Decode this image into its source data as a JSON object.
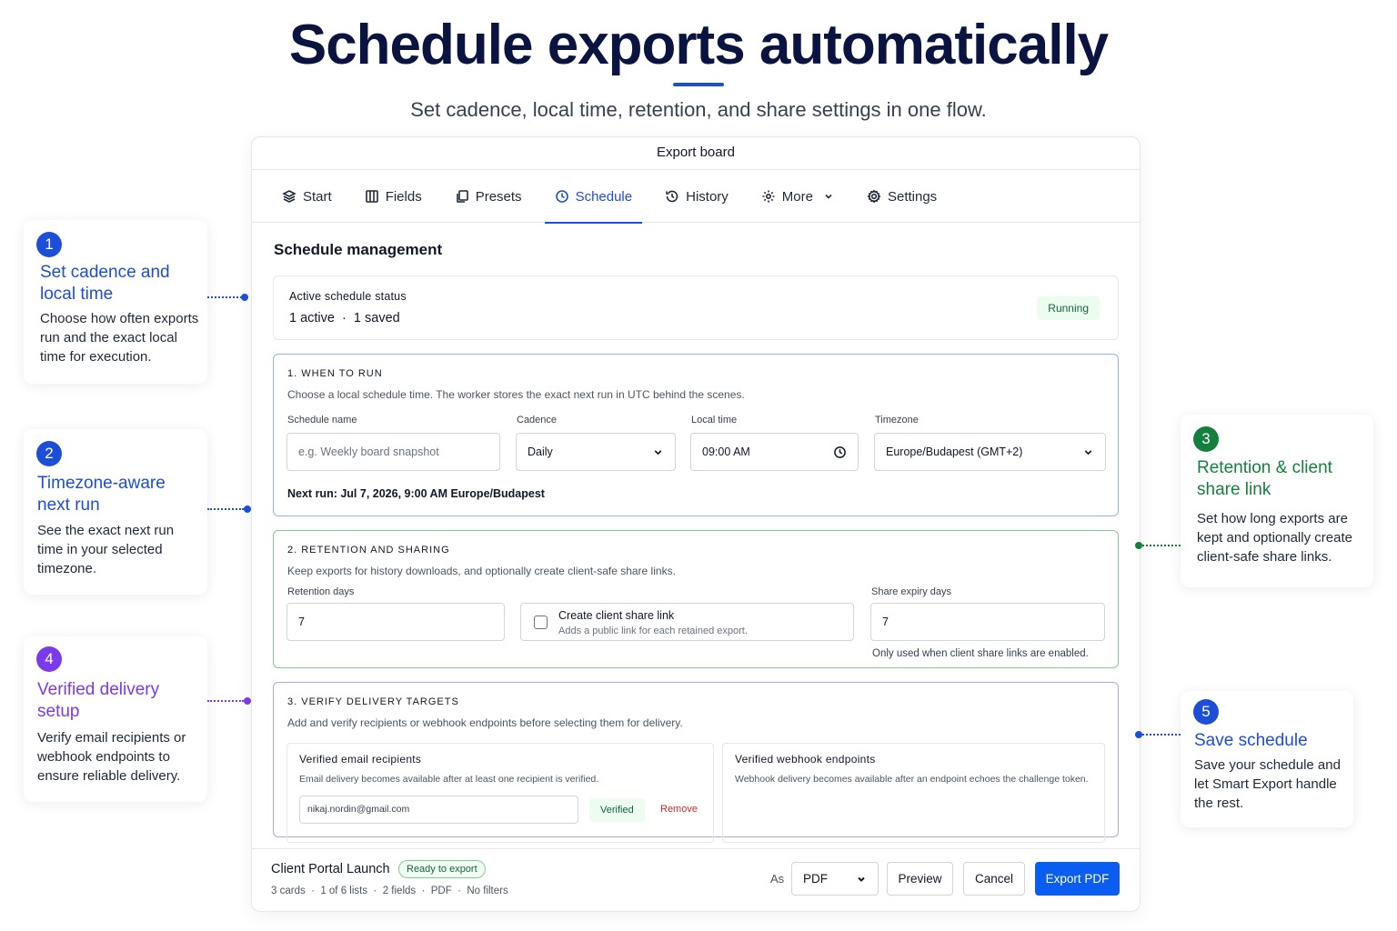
{
  "hero": {
    "title": "Schedule exports automatically",
    "subtitle": "Set cadence, local time, retention, and share settings in one flow."
  },
  "card": {
    "title": "Export board",
    "tabs": [
      {
        "label": "Start",
        "icon": "layers-icon"
      },
      {
        "label": "Fields",
        "icon": "columns-icon"
      },
      {
        "label": "Presets",
        "icon": "copy-icon"
      },
      {
        "label": "Schedule",
        "icon": "clock-icon",
        "active": true
      },
      {
        "label": "History",
        "icon": "history-icon"
      },
      {
        "label": "More",
        "icon": "gear-cluster-icon"
      },
      {
        "label": "Settings",
        "icon": "gear-icon"
      }
    ],
    "section_title": "Schedule management",
    "status": {
      "label": "Active schedule status",
      "value": "1 active  ·  1 saved",
      "badge": "Running"
    },
    "step1": {
      "label": "1. When to run",
      "desc": "Choose a local schedule time. The worker stores the exact next run in UTC behind the scenes.",
      "schedule_name_label": "Schedule name",
      "schedule_name_placeholder": "e.g. Weekly board snapshot",
      "cadence_label": "Cadence",
      "cadence_value": "Daily",
      "local_time_label": "Local time",
      "local_time_value": "09:00 AM",
      "timezone_label": "Timezone",
      "timezone_value": "Europe/Budapest (GMT+2)",
      "next_run": "Next run: Jul 7, 2026, 9:00 AM Europe/Budapest"
    },
    "step2": {
      "label": "2. Retention and sharing",
      "desc": "Keep exports for history downloads, and optionally create client-safe share links.",
      "retention_label": "Retention days",
      "retention_value": "7",
      "share_link_title": "Create client share link",
      "share_link_sub": "Adds a public link for each retained export.",
      "expiry_label": "Share expiry days",
      "expiry_value": "7",
      "expiry_helper": "Only used when client share links are enabled."
    },
    "step3": {
      "label": "3. Verify delivery targets",
      "desc": "Add and verify recipients or webhook endpoints before selecting them for delivery.",
      "email_panel_title": "Verified email recipients",
      "email_panel_desc": "Email delivery becomes available after at least one recipient is verified.",
      "email_value": "nikaj.nordin@gmail.com",
      "verified_badge": "Verified",
      "remove_label": "Remove",
      "webhook_panel_title": "Verified webhook endpoints",
      "webhook_panel_desc": "Webhook delivery becomes available after an endpoint echoes the challenge token."
    },
    "footer": {
      "project_name": "Client Portal Launch",
      "ready_badge": "Ready to export",
      "meta": "3 cards  ·  1 of 6 lists  ·  2 fields  ·  PDF  ·  No filters",
      "as_label": "As",
      "format_value": "PDF",
      "preview_label": "Preview",
      "cancel_label": "Cancel",
      "export_label": "Export PDF"
    }
  },
  "callouts": [
    {
      "num": "1",
      "title": "Set cadence and local time",
      "body": "Choose how often exports run and the exact local time for execution.",
      "color": "#1d4ed8"
    },
    {
      "num": "2",
      "title": "Timezone-aware next run",
      "body": "See the exact next run time in your selected timezone.",
      "color": "#1d4ed8"
    },
    {
      "num": "3",
      "title": "Retention & client share link",
      "body": "Set how long exports are kept and optionally create client-safe share links.",
      "color": "#15803d"
    },
    {
      "num": "4",
      "title": "Verified delivery setup",
      "body": "Verify email recipients or webhook endpoints to ensure reliable delivery.",
      "color": "#7c3aed"
    },
    {
      "num": "5",
      "title": "Save schedule",
      "body": "Save your schedule and let Smart Export handle the rest.",
      "color": "#1d4ed8"
    }
  ]
}
